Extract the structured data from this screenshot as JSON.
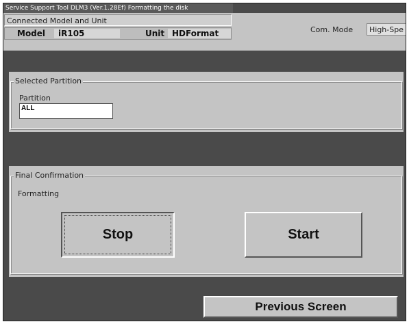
{
  "window": {
    "title": "Service Support Tool DLM3 (Ver.1.28Ef) Formatting the disk"
  },
  "header": {
    "connected_label": "Connected Model and Unit",
    "model_label": "Model",
    "model_value": "iR105",
    "unit_label": "Unit",
    "unit_value": "HDFormat",
    "com_mode_label": "Com. Mode",
    "com_mode_value": "High-Spe"
  },
  "selected_partition": {
    "title": "Selected Partition",
    "partition_label": "Partition",
    "partition_value": "ALL"
  },
  "final_confirmation": {
    "title": "Final Confirmation",
    "status": "Formatting",
    "stop_label": "Stop",
    "start_label": "Start"
  },
  "footer": {
    "previous_label": "Previous Screen"
  }
}
